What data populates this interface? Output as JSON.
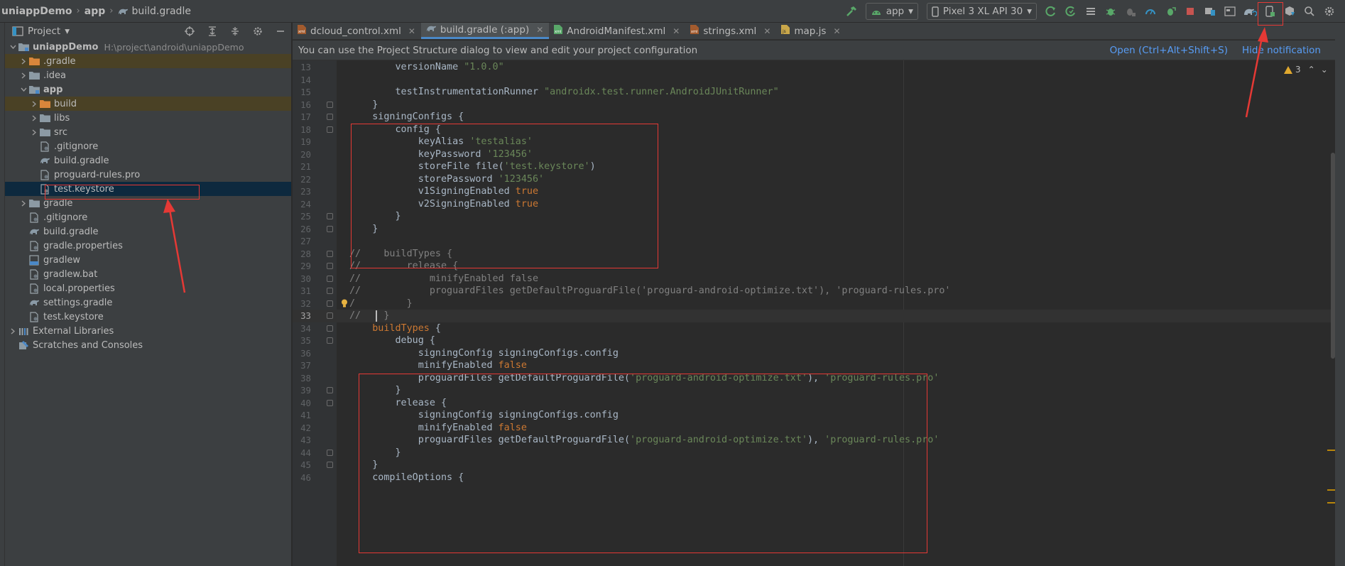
{
  "breadcrumb": {
    "project": "uniappDemo",
    "module": "app",
    "file": "build.gradle"
  },
  "toolbar": {
    "run_config": "app",
    "device": "Pixel 3 XL API 30"
  },
  "project_panel": {
    "title": "Project",
    "tree": [
      {
        "label": "uniappDemo",
        "extra": "H:\\project\\android\\uniappDemo",
        "depth": 0,
        "arrow": "down",
        "icon": "module-folder-icon",
        "bold": true
      },
      {
        "label": ".gradle",
        "depth": 1,
        "arrow": "right",
        "icon": "folder-orange-icon",
        "hl": true
      },
      {
        "label": ".idea",
        "depth": 1,
        "arrow": "right",
        "icon": "folder-icon"
      },
      {
        "label": "app",
        "depth": 1,
        "arrow": "down",
        "icon": "module-folder-icon",
        "bold": true
      },
      {
        "label": "build",
        "depth": 2,
        "arrow": "right",
        "icon": "folder-orange-icon",
        "hl": true
      },
      {
        "label": "libs",
        "depth": 2,
        "arrow": "right",
        "icon": "folder-icon"
      },
      {
        "label": "src",
        "depth": 2,
        "arrow": "right",
        "icon": "folder-icon"
      },
      {
        "label": ".gitignore",
        "depth": 2,
        "arrow": "none",
        "icon": "file-icon"
      },
      {
        "label": "build.gradle",
        "depth": 2,
        "arrow": "none",
        "icon": "gradle-icon"
      },
      {
        "label": "proguard-rules.pro",
        "depth": 2,
        "arrow": "none",
        "icon": "file-icon"
      },
      {
        "label": "test.keystore",
        "depth": 2,
        "arrow": "none",
        "icon": "file-icon",
        "sel": true
      },
      {
        "label": "gradle",
        "depth": 1,
        "arrow": "right",
        "icon": "folder-icon"
      },
      {
        "label": ".gitignore",
        "depth": 1,
        "arrow": "none",
        "icon": "file-icon"
      },
      {
        "label": "build.gradle",
        "depth": 1,
        "arrow": "none",
        "icon": "gradle-icon"
      },
      {
        "label": "gradle.properties",
        "depth": 1,
        "arrow": "none",
        "icon": "file-icon"
      },
      {
        "label": "gradlew",
        "depth": 1,
        "arrow": "none",
        "icon": "shell-icon"
      },
      {
        "label": "gradlew.bat",
        "depth": 1,
        "arrow": "none",
        "icon": "file-icon"
      },
      {
        "label": "local.properties",
        "depth": 1,
        "arrow": "none",
        "icon": "file-icon"
      },
      {
        "label": "settings.gradle",
        "depth": 1,
        "arrow": "none",
        "icon": "gradle-icon"
      },
      {
        "label": "test.keystore",
        "depth": 1,
        "arrow": "none",
        "icon": "file-icon"
      },
      {
        "label": "External Libraries",
        "depth": 0,
        "arrow": "right",
        "icon": "library-icon"
      },
      {
        "label": "Scratches and Consoles",
        "depth": 0,
        "arrow": "none",
        "icon": "scratch-icon"
      }
    ]
  },
  "tabs": [
    {
      "label": "dcloud_control.xml",
      "icon": "xml-icon",
      "active": false
    },
    {
      "label": "build.gradle (:app)",
      "icon": "gradle-icon",
      "active": true
    },
    {
      "label": "AndroidManifest.xml",
      "icon": "manifest-icon",
      "active": false
    },
    {
      "label": "strings.xml",
      "icon": "xml-icon",
      "active": false
    },
    {
      "label": "map.js",
      "icon": "js-icon",
      "active": false
    }
  ],
  "notification": {
    "message": "You can use the Project Structure dialog to view and edit your project configuration",
    "open_link": "Open (Ctrl+Alt+Shift+S)",
    "hide_link": "Hide notification"
  },
  "inspections": {
    "warnings": "3"
  },
  "editor": {
    "current_line": 33,
    "lines": [
      {
        "n": 13,
        "segs": [
          [
            "p",
            "        versionName "
          ],
          [
            "s",
            "\"1.0.0\""
          ]
        ]
      },
      {
        "n": 14,
        "segs": []
      },
      {
        "n": 15,
        "segs": [
          [
            "p",
            "        testInstrumentationRunner "
          ],
          [
            "s",
            "\"androidx.test.runner.AndroidJUnitRunner\""
          ]
        ]
      },
      {
        "n": 16,
        "segs": [
          [
            "p",
            "    }"
          ]
        ]
      },
      {
        "n": 17,
        "segs": [
          [
            "p",
            "    signingConfigs {"
          ]
        ]
      },
      {
        "n": 18,
        "segs": [
          [
            "p",
            "        config {"
          ]
        ]
      },
      {
        "n": 19,
        "segs": [
          [
            "p",
            "            keyAlias "
          ],
          [
            "s",
            "'testalias'"
          ]
        ]
      },
      {
        "n": 20,
        "segs": [
          [
            "p",
            "            keyPassword "
          ],
          [
            "s",
            "'123456'"
          ]
        ]
      },
      {
        "n": 21,
        "segs": [
          [
            "p",
            "            storeFile file("
          ],
          [
            "s",
            "'test.keystore'"
          ],
          [
            "p",
            ")"
          ]
        ]
      },
      {
        "n": 22,
        "segs": [
          [
            "p",
            "            storePassword "
          ],
          [
            "s",
            "'123456'"
          ]
        ]
      },
      {
        "n": 23,
        "segs": [
          [
            "p",
            "            v1SigningEnabled "
          ],
          [
            "k",
            "true"
          ]
        ]
      },
      {
        "n": 24,
        "segs": [
          [
            "p",
            "            v2SigningEnabled "
          ],
          [
            "k",
            "true"
          ]
        ]
      },
      {
        "n": 25,
        "segs": [
          [
            "p",
            "        }"
          ]
        ]
      },
      {
        "n": 26,
        "segs": [
          [
            "p",
            "    }"
          ]
        ]
      },
      {
        "n": 27,
        "segs": []
      },
      {
        "n": 28,
        "segs": [
          [
            "c",
            "//    buildTypes {"
          ]
        ]
      },
      {
        "n": 29,
        "segs": [
          [
            "c",
            "//        release {"
          ]
        ]
      },
      {
        "n": 30,
        "segs": [
          [
            "c",
            "//            minifyEnabled false"
          ]
        ]
      },
      {
        "n": 31,
        "segs": [
          [
            "c",
            "//            proguardFiles getDefaultProguardFile('proguard-android-optimize.txt'), 'proguard-rules.pro'"
          ]
        ]
      },
      {
        "n": 32,
        "segs": [
          [
            "c",
            "/         }"
          ]
        ]
      },
      {
        "n": 33,
        "segs": [
          [
            "c",
            "//    }"
          ]
        ]
      },
      {
        "n": 34,
        "segs": [
          [
            "k",
            "    buildTypes"
          ],
          [
            "p",
            " {"
          ]
        ]
      },
      {
        "n": 35,
        "segs": [
          [
            "p",
            "        debug {"
          ]
        ]
      },
      {
        "n": 36,
        "segs": [
          [
            "p",
            "            signingConfig signingConfigs.config"
          ]
        ]
      },
      {
        "n": 37,
        "segs": [
          [
            "p",
            "            minifyEnabled "
          ],
          [
            "k",
            "false"
          ]
        ]
      },
      {
        "n": 38,
        "segs": [
          [
            "p",
            "            proguardFiles getDefaultProguardFile("
          ],
          [
            "s",
            "'proguard-android-optimize.txt'"
          ],
          [
            "p",
            "), "
          ],
          [
            "s",
            "'proguard-rules.pro'"
          ]
        ]
      },
      {
        "n": 39,
        "segs": [
          [
            "p",
            "        }"
          ]
        ]
      },
      {
        "n": 40,
        "segs": [
          [
            "p",
            "        release {"
          ]
        ]
      },
      {
        "n": 41,
        "segs": [
          [
            "p",
            "            signingConfig signingConfigs.config"
          ]
        ]
      },
      {
        "n": 42,
        "segs": [
          [
            "p",
            "            minifyEnabled "
          ],
          [
            "k",
            "false"
          ]
        ]
      },
      {
        "n": 43,
        "segs": [
          [
            "p",
            "            proguardFiles getDefaultProguardFile("
          ],
          [
            "s",
            "'proguard-android-optimize.txt'"
          ],
          [
            "p",
            "), "
          ],
          [
            "s",
            "'proguard-rules.pro'"
          ]
        ]
      },
      {
        "n": 44,
        "segs": [
          [
            "p",
            "        }"
          ]
        ]
      },
      {
        "n": 45,
        "segs": [
          [
            "p",
            "    }"
          ]
        ]
      },
      {
        "n": 46,
        "segs": [
          [
            "p",
            "    compileOptions {"
          ]
        ]
      }
    ]
  },
  "colors": {
    "accent": "#4a88c7",
    "annotation": "#e53935",
    "string": "#6a8759",
    "keyword": "#cc7832",
    "comment": "#808080"
  }
}
